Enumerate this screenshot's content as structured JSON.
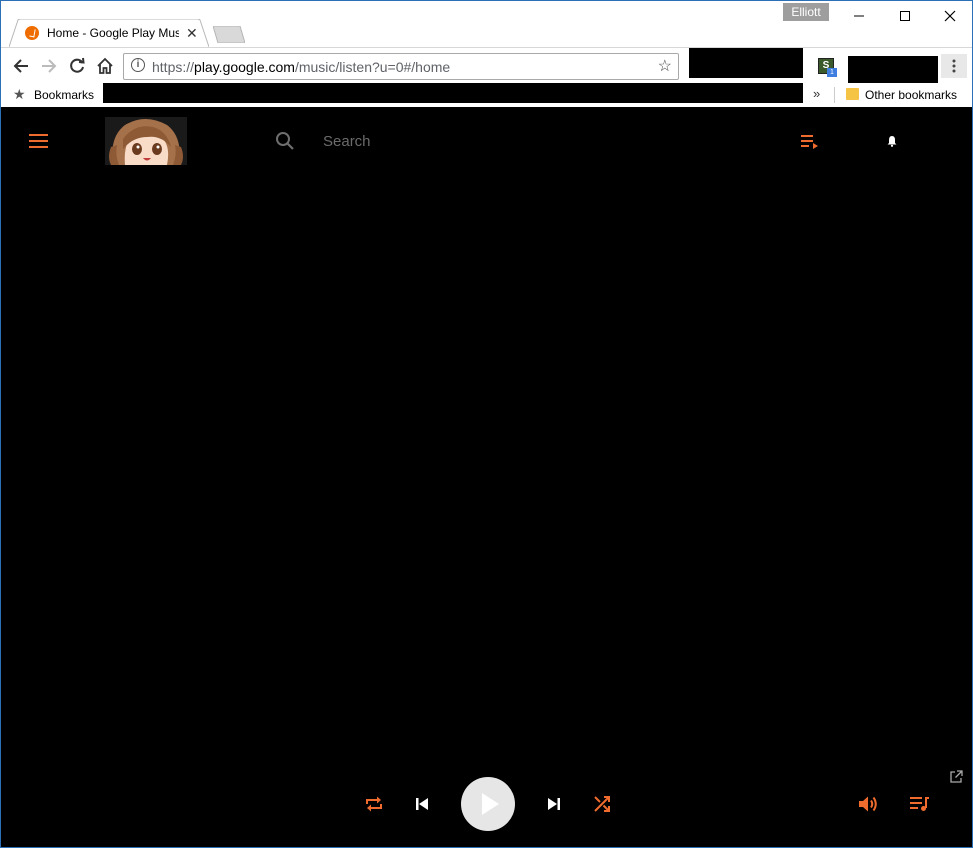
{
  "browser": {
    "profile_name": "Elliott",
    "tab": {
      "title": "Home - Google Play Music"
    },
    "omnibox": {
      "scheme": "https://",
      "host": "play.google.com",
      "path": "/music/listen?u=0#/home"
    },
    "bookmarks_bar": {
      "bookmarks_label": "Bookmarks",
      "other_bookmarks_label": "Other bookmarks",
      "overflow": "»"
    },
    "extension": {
      "letter": "S",
      "badge": "1"
    }
  },
  "app": {
    "search": {
      "placeholder": "Search"
    },
    "accent_color": "#ef6c2e",
    "icons": [
      "menu-icon",
      "search-icon",
      "queue-icon",
      "notification-bell-icon",
      "repeat-icon",
      "previous-icon",
      "play-icon",
      "next-icon",
      "shuffle-icon",
      "volume-icon",
      "queue-music-icon",
      "popout-icon"
    ]
  }
}
